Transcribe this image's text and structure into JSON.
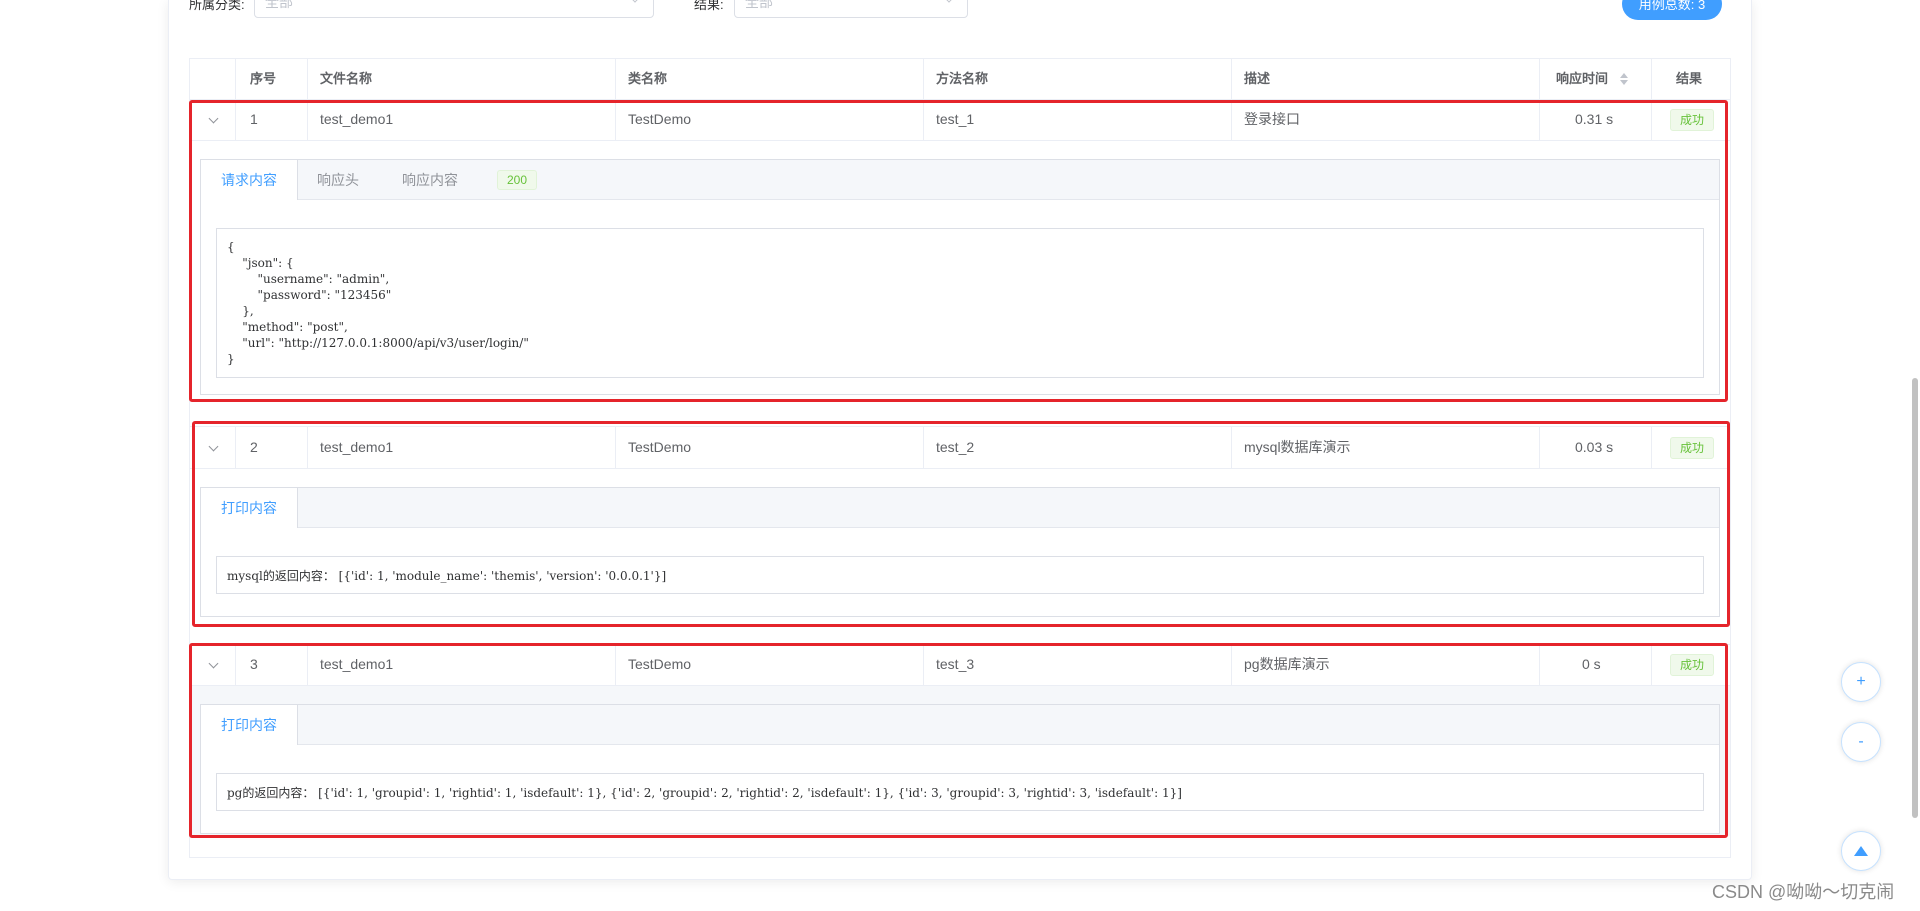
{
  "filters": {
    "category_label": "所属分类:",
    "category_value": "全部",
    "result_label": "结果:",
    "result_value": "全部",
    "total_button": "用例总数: 3"
  },
  "table": {
    "headers": {
      "index": "序号",
      "file": "文件名称",
      "class": "类名称",
      "method": "方法名称",
      "desc": "描述",
      "time": "响应时间",
      "result": "结果"
    },
    "rows": [
      {
        "index": "1",
        "file": "test_demo1",
        "class": "TestDemo",
        "method": "test_1",
        "desc": "登录接口",
        "time": "0.31 s",
        "result": "成功",
        "tabs": [
          "请求内容",
          "响应头",
          "响应内容"
        ],
        "status_code": "200",
        "content": "{\n    \"json\": {\n        \"username\": \"admin\",\n        \"password\": \"123456\"\n    },\n    \"method\": \"post\",\n    \"url\": \"http://127.0.0.1:8000/api/v3/user/login/\"\n}"
      },
      {
        "index": "2",
        "file": "test_demo1",
        "class": "TestDemo",
        "method": "test_2",
        "desc": "mysql数据库演示",
        "time": "0.03 s",
        "result": "成功",
        "tabs": [
          "打印内容"
        ],
        "content": "mysql的返回内容： [{'id': 1, 'module_name': 'themis', 'version': '0.0.0.1'}]"
      },
      {
        "index": "3",
        "file": "test_demo1",
        "class": "TestDemo",
        "method": "test_3",
        "desc": "pg数据库演示",
        "time": "0 s",
        "result": "成功",
        "tabs": [
          "打印内容"
        ],
        "content": "pg的返回内容： [{'id': 1, 'groupid': 1, 'rightid': 1, 'isdefault': 1}, {'id': 2, 'groupid': 2, 'rightid': 2, 'isdefault': 1}, {'id': 3, 'groupid': 3, 'rightid': 3, 'isdefault': 1}]"
      }
    ]
  },
  "float_buttons": {
    "plus": "+",
    "minus": "-"
  },
  "watermark": "CSDN @呦呦～切克闹",
  "colors": {
    "accent": "#409eff",
    "success": "#67c23a",
    "highlight_border": "#e5242b"
  },
  "icons": [
    "chevron-down-icon",
    "sort-icon",
    "plus-icon",
    "minus-icon",
    "caret-up-icon"
  ]
}
